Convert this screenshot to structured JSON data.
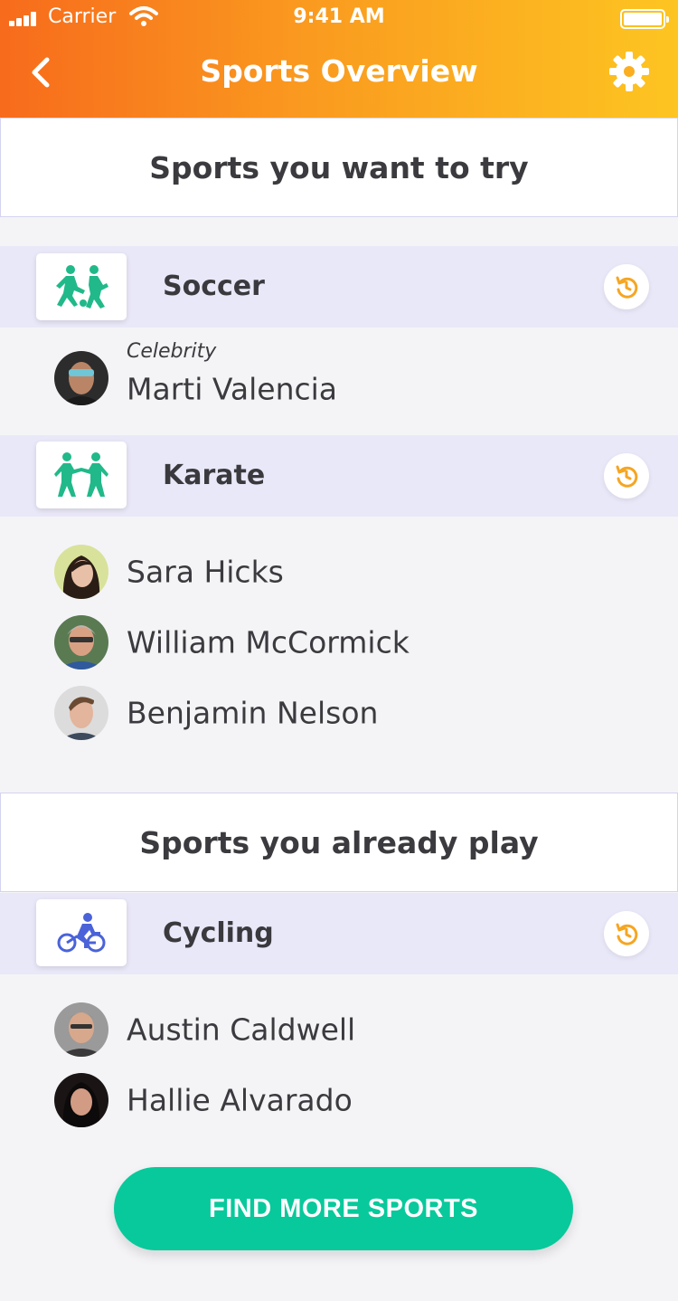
{
  "status_bar": {
    "carrier": "Carrier",
    "time": "9:41 AM"
  },
  "header": {
    "title": "Sports Overview",
    "back_icon": "chevron-left-icon",
    "settings_icon": "gear-icon"
  },
  "colors": {
    "gradient_start": "#f76b1c",
    "gradient_end": "#fdc521",
    "accent_green": "#08c99b",
    "reset_orange": "#f5a623",
    "sport_row_bg": "#e9e8f8"
  },
  "want_section": {
    "title": "Sports you want to try",
    "sports": [
      {
        "name": "Soccer",
        "icon": "soccer-players-icon",
        "people": [
          {
            "tag": "Celebrity",
            "name": "Marti Valencia"
          }
        ]
      },
      {
        "name": "Karate",
        "icon": "karate-fighters-icon",
        "people": [
          {
            "name": "Sara Hicks"
          },
          {
            "name": "William McCormick"
          },
          {
            "name": "Benjamin Nelson"
          }
        ]
      }
    ]
  },
  "play_section": {
    "title": "Sports you already play",
    "sports": [
      {
        "name": "Cycling",
        "icon": "cyclist-icon",
        "people": [
          {
            "name": "Austin Caldwell"
          },
          {
            "name": "Hallie Alvarado"
          }
        ]
      }
    ]
  },
  "cta": {
    "label": "FIND MORE SPORTS"
  }
}
